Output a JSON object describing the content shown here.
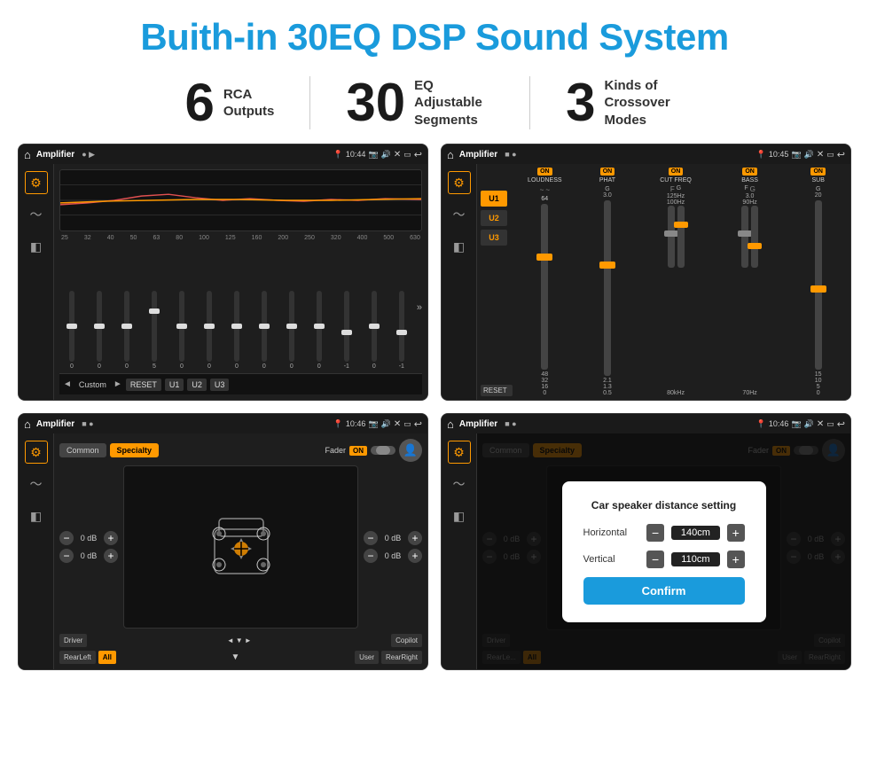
{
  "header": {
    "title": "Buith-in 30EQ DSP Sound System"
  },
  "stats": [
    {
      "number": "6",
      "label": "RCA\nOutputs"
    },
    {
      "number": "30",
      "label": "EQ Adjustable\nSegments"
    },
    {
      "number": "3",
      "label": "Kinds of\nCrossover Modes"
    }
  ],
  "screens": [
    {
      "id": "eq-screen",
      "title": "Amplifier",
      "time": "10:44",
      "type": "eq"
    },
    {
      "id": "crossover-screen",
      "title": "Amplifier",
      "time": "10:45",
      "type": "crossover"
    },
    {
      "id": "fader-screen",
      "title": "Amplifier",
      "time": "10:46",
      "type": "fader"
    },
    {
      "id": "distance-screen",
      "title": "Amplifier",
      "time": "10:46",
      "type": "distance"
    }
  ],
  "eq": {
    "frequencies": [
      "25",
      "32",
      "40",
      "50",
      "63",
      "80",
      "100",
      "125",
      "160",
      "200",
      "250",
      "320",
      "400",
      "500",
      "630"
    ],
    "values": [
      "0",
      "0",
      "0",
      "5",
      "0",
      "0",
      "0",
      "0",
      "0",
      "0",
      "-1",
      "0",
      "-1"
    ],
    "preset": "Custom",
    "buttons": [
      "RESET",
      "U1",
      "U2",
      "U3"
    ]
  },
  "crossover": {
    "presets": [
      "U1",
      "U2",
      "U3"
    ],
    "columns": [
      {
        "label": "LOUDNESS",
        "on": true
      },
      {
        "label": "PHAT",
        "on": true
      },
      {
        "label": "CUT FREQ",
        "on": true
      },
      {
        "label": "BASS",
        "on": true
      },
      {
        "label": "SUB",
        "on": true
      }
    ],
    "resetLabel": "RESET"
  },
  "fader": {
    "tabs": [
      "Common",
      "Specialty"
    ],
    "activeTab": "Specialty",
    "faderLabel": "Fader",
    "onLabel": "ON",
    "zones": [
      "Driver",
      "RearLeft",
      "All",
      "User",
      "RearRight",
      "Copilot"
    ],
    "dbValues": [
      "0 dB",
      "0 dB",
      "0 dB",
      "0 dB"
    ]
  },
  "dialog": {
    "title": "Car speaker distance setting",
    "horizontal": {
      "label": "Horizontal",
      "value": "140cm"
    },
    "vertical": {
      "label": "Vertical",
      "value": "110cm"
    },
    "confirm": "Confirm"
  }
}
